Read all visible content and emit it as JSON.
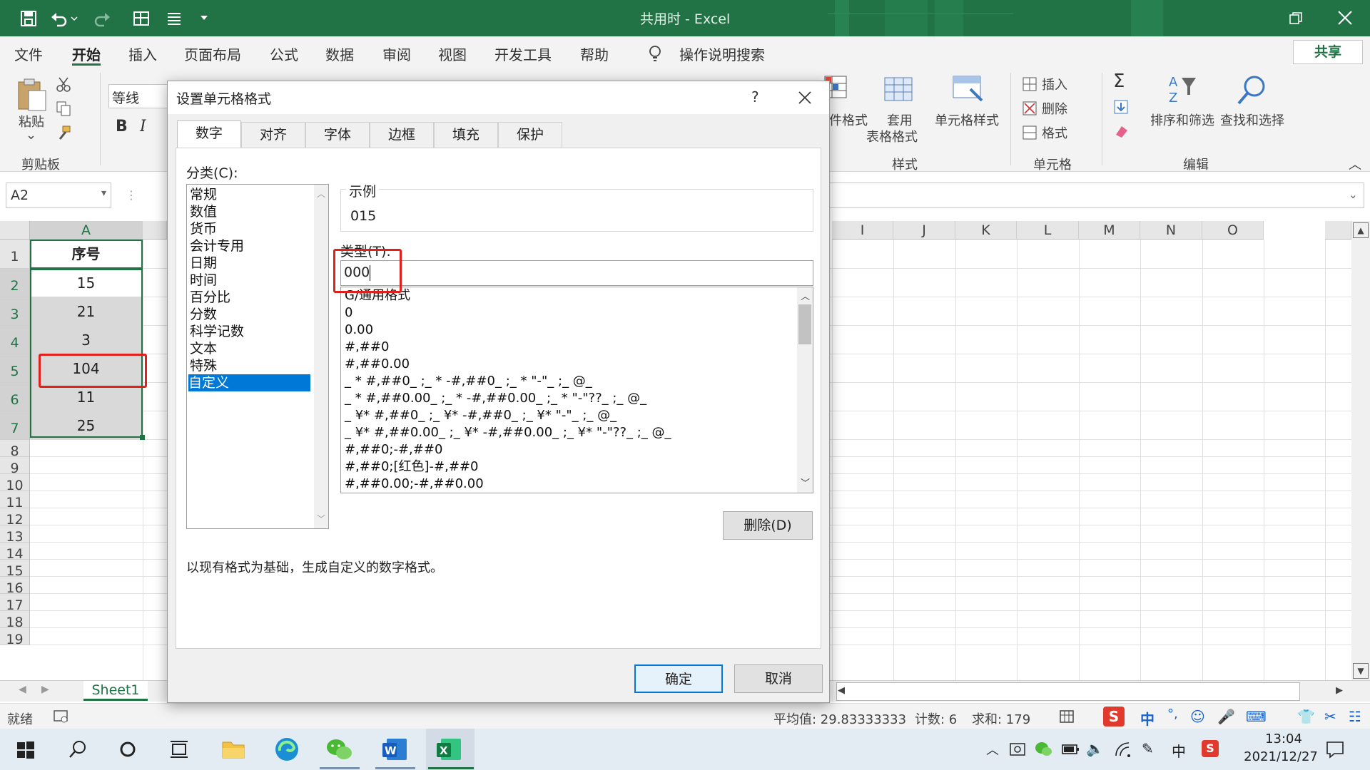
{
  "window": {
    "title": "共用时  -  Excel"
  },
  "menu": {
    "items": [
      "文件",
      "开始",
      "插入",
      "页面布局",
      "公式",
      "数据",
      "审阅",
      "视图",
      "开发工具",
      "帮助"
    ],
    "search": "操作说明搜索",
    "share": "共享"
  },
  "ribbon": {
    "paste": "粘贴",
    "clipboard_group": "剪贴板",
    "font_name": "等线",
    "bold": "B",
    "italic": "I",
    "cond_format": "件格式",
    "table_format_1": "套用",
    "table_format_2": "表格格式",
    "cell_styles": "单元格样式",
    "styles_group": "样式",
    "insert": "插入",
    "delete": "删除",
    "format": "格式",
    "cells_group": "单元格",
    "sort_filter": "排序和筛选",
    "find_select": "查找和选择",
    "editing_group": "编辑"
  },
  "formula_bar": {
    "name_box": "A2",
    "fx": ""
  },
  "grid": {
    "col_a": "A",
    "right_cols": [
      "I",
      "J",
      "K",
      "L",
      "M",
      "N",
      "O"
    ],
    "rows": [
      "1",
      "2",
      "3",
      "4",
      "5",
      "6",
      "7",
      "8",
      "9",
      "10",
      "11",
      "12",
      "13",
      "14",
      "15",
      "16",
      "17",
      "18",
      "19"
    ],
    "cells_a": [
      "序号",
      "15",
      "21",
      "3",
      "104",
      "11",
      "25"
    ]
  },
  "sheet": {
    "tab": "Sheet1"
  },
  "statusbar": {
    "ready": "就绪",
    "average": "平均值: 29.83333333",
    "count": "计数: 6",
    "sum": "求和: 179"
  },
  "taskbar": {
    "time": "13:04",
    "date": "2021/12/27"
  },
  "dialog": {
    "title": "设置单元格格式",
    "help": "?",
    "tabs": [
      "数字",
      "对齐",
      "字体",
      "边框",
      "填充",
      "保护"
    ],
    "category_label": "分类(C):",
    "categories": [
      "常规",
      "数值",
      "货币",
      "会计专用",
      "日期",
      "时间",
      "百分比",
      "分数",
      "科学记数",
      "文本",
      "特殊",
      "自定义"
    ],
    "sample_label": "示例",
    "sample_value": "015",
    "type_label": "类型(T):",
    "type_value": "000",
    "formats": [
      "G/通用格式",
      "0",
      "0.00",
      "#,##0",
      "#,##0.00",
      "_ * #,##0_ ;_ * -#,##0_ ;_ * \"-\"_ ;_ @_",
      "_ * #,##0.00_ ;_ * -#,##0.00_ ;_ * \"-\"??_ ;_ @_",
      "_ ¥* #,##0_ ;_ ¥* -#,##0_ ;_ ¥* \"-\"_ ;_ @_",
      "_ ¥* #,##0.00_ ;_ ¥* -#,##0.00_ ;_ ¥* \"-\"??_ ;_ @_",
      "#,##0;-#,##0",
      "#,##0;[红色]-#,##0",
      "#,##0.00;-#,##0.00"
    ],
    "delete_btn": "删除(D)",
    "description": "以现有格式为基础，生成自定义的数字格式。",
    "ok": "确定",
    "cancel": "取消"
  },
  "colors": {
    "excel_green": "#217346",
    "highlight": "#e0201b",
    "selection": "#0078d7"
  }
}
